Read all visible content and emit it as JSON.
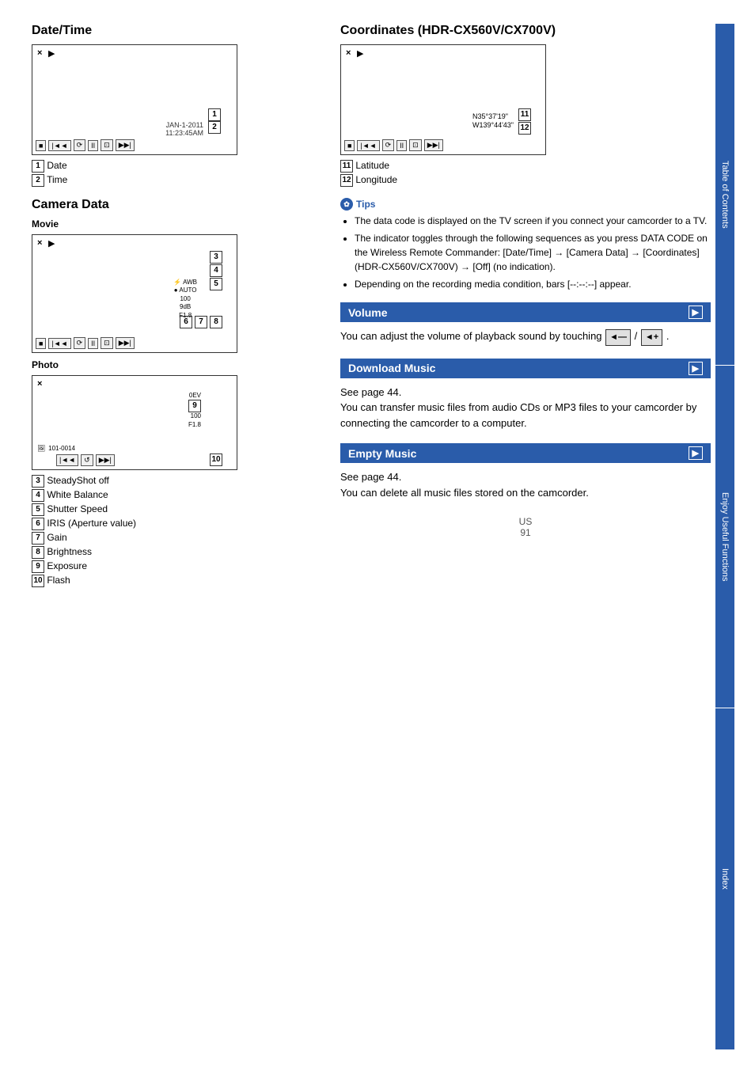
{
  "page": {
    "number": "91",
    "locale": "US"
  },
  "sidebar": {
    "sections": [
      {
        "id": "table-of-contents",
        "label": "Table of Contents"
      },
      {
        "id": "enjoy",
        "label": "Enjoy Useful Functions"
      },
      {
        "id": "index",
        "label": "Index"
      }
    ]
  },
  "left": {
    "datetime": {
      "title": "Date/Time",
      "number1": "1",
      "number2": "2",
      "label1": "Date",
      "label2": "Time",
      "screen_date": "JAN-1-2011",
      "screen_time": "11:23:45AM"
    },
    "cameradata": {
      "title": "Camera Data",
      "movie_subtitle": "Movie",
      "photo_subtitle": "Photo",
      "awb": "AWB",
      "auto": "AUTO",
      "shutter": "100",
      "brightness": "9dB",
      "aperture": "F1.8",
      "exposure": "0EV",
      "photo_shutter": "100",
      "photo_aperture": "F1.8",
      "photo_num": "101-0014",
      "numbers": {
        "n3": "3",
        "n4": "4",
        "n5": "5",
        "n6": "6",
        "n7": "7",
        "n8": "8",
        "n9": "9",
        "n10": "10"
      }
    },
    "labels": [
      {
        "num": "3",
        "text": "SteadyShot off"
      },
      {
        "num": "4",
        "text": "White Balance"
      },
      {
        "num": "5",
        "text": "Shutter Speed"
      },
      {
        "num": "6",
        "text": "IRIS (Aperture value)"
      },
      {
        "num": "7",
        "text": "Gain"
      },
      {
        "num": "8",
        "text": "Brightness"
      },
      {
        "num": "9",
        "text": "Exposure"
      },
      {
        "num": "10",
        "text": "Flash"
      }
    ]
  },
  "right": {
    "coordinates": {
      "title": "Coordinates (HDR-CX560V/CX700V)",
      "lat_text": "N35°37'19\"",
      "lon_text": "W139°44'43\"",
      "number11": "11",
      "number12": "12",
      "label11": "Latitude",
      "label12": "Longitude"
    },
    "tips": {
      "title": "Tips",
      "items": [
        "The data code is displayed on the TV screen if you connect your camcorder to a TV.",
        "The indicator toggles through the following sequences as you press DATA CODE on the Wireless Remote Commander: [Date/Time] → [Camera Data] → [Coordinates] (HDR-CX560V/CX700V) → [Off] (no indication).",
        "Depending on the recording media condition, bars [--:--:--] appear."
      ]
    },
    "volume": {
      "title": "Volume",
      "body": "You can adjust the volume of playback sound by touching",
      "icon_minus": "◄—",
      "icon_plus": "◄+"
    },
    "download_music": {
      "title": "Download Music",
      "see_page": "See page 44.",
      "body": "You can transfer music files from audio CDs or MP3 files to your camcorder by connecting the camcorder to a computer."
    },
    "empty_music": {
      "title": "Empty Music",
      "see_page": "See page 44.",
      "body": "You can delete all music files stored on the camcorder."
    }
  }
}
